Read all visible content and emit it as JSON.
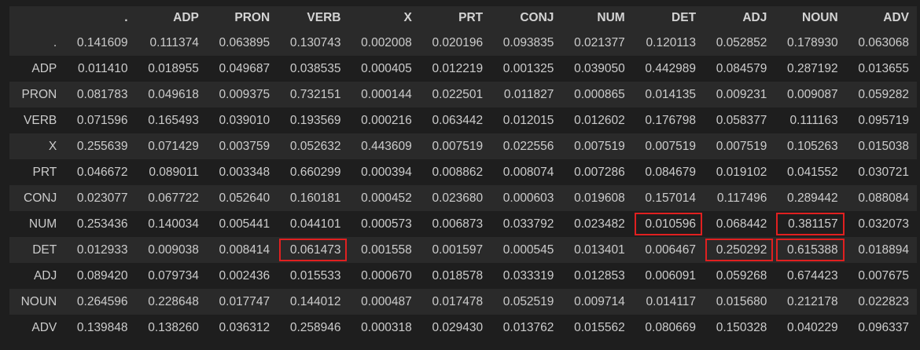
{
  "table": {
    "columns": [
      ".",
      "ADP",
      "PRON",
      "VERB",
      "X",
      "PRT",
      "CONJ",
      "NUM",
      "DET",
      "ADJ",
      "NOUN",
      "ADV"
    ],
    "rows": [
      {
        "label": ".",
        "values": [
          "0.141609",
          "0.111374",
          "0.063895",
          "0.130743",
          "0.002008",
          "0.020196",
          "0.093835",
          "0.021377",
          "0.120113",
          "0.052852",
          "0.178930",
          "0.063068"
        ],
        "highlight": []
      },
      {
        "label": "ADP",
        "values": [
          "0.011410",
          "0.018955",
          "0.049687",
          "0.038535",
          "0.000405",
          "0.012219",
          "0.001325",
          "0.039050",
          "0.442989",
          "0.084579",
          "0.287192",
          "0.013655"
        ],
        "highlight": []
      },
      {
        "label": "PRON",
        "values": [
          "0.081783",
          "0.049618",
          "0.009375",
          "0.732151",
          "0.000144",
          "0.022501",
          "0.011827",
          "0.000865",
          "0.014135",
          "0.009231",
          "0.009087",
          "0.059282"
        ],
        "highlight": []
      },
      {
        "label": "VERB",
        "values": [
          "0.071596",
          "0.165493",
          "0.039010",
          "0.193569",
          "0.000216",
          "0.063442",
          "0.012015",
          "0.012602",
          "0.176798",
          "0.058377",
          "0.111163",
          "0.095719"
        ],
        "highlight": []
      },
      {
        "label": "X",
        "values": [
          "0.255639",
          "0.071429",
          "0.003759",
          "0.052632",
          "0.443609",
          "0.007519",
          "0.022556",
          "0.007519",
          "0.007519",
          "0.007519",
          "0.105263",
          "0.015038"
        ],
        "highlight": []
      },
      {
        "label": "PRT",
        "values": [
          "0.046672",
          "0.089011",
          "0.003348",
          "0.660299",
          "0.000394",
          "0.008862",
          "0.008074",
          "0.007286",
          "0.084679",
          "0.019102",
          "0.041552",
          "0.030721"
        ],
        "highlight": []
      },
      {
        "label": "CONJ",
        "values": [
          "0.023077",
          "0.067722",
          "0.052640",
          "0.160181",
          "0.000452",
          "0.023680",
          "0.000603",
          "0.019608",
          "0.157014",
          "0.117496",
          "0.289442",
          "0.088084"
        ],
        "highlight": []
      },
      {
        "label": "NUM",
        "values": [
          "0.253436",
          "0.140034",
          "0.005441",
          "0.044101",
          "0.000573",
          "0.006873",
          "0.033792",
          "0.023482",
          "0.010596",
          "0.068442",
          "0.381157",
          "0.032073"
        ],
        "highlight": [
          8,
          10
        ]
      },
      {
        "label": "DET",
        "values": [
          "0.012933",
          "0.009038",
          "0.008414",
          "0.061473",
          "0.001558",
          "0.001597",
          "0.000545",
          "0.013401",
          "0.006467",
          "0.250292",
          "0.615388",
          "0.018894"
        ],
        "highlight": [
          3,
          9,
          10
        ]
      },
      {
        "label": "ADJ",
        "values": [
          "0.089420",
          "0.079734",
          "0.002436",
          "0.015533",
          "0.000670",
          "0.018578",
          "0.033319",
          "0.012853",
          "0.006091",
          "0.059268",
          "0.674423",
          "0.007675"
        ],
        "highlight": []
      },
      {
        "label": "NOUN",
        "values": [
          "0.264596",
          "0.228648",
          "0.017747",
          "0.144012",
          "0.000487",
          "0.017478",
          "0.052519",
          "0.009714",
          "0.014117",
          "0.015680",
          "0.212178",
          "0.022823"
        ],
        "highlight": []
      },
      {
        "label": "ADV",
        "values": [
          "0.139848",
          "0.138260",
          "0.036312",
          "0.258946",
          "0.000318",
          "0.029430",
          "0.013762",
          "0.015562",
          "0.080669",
          "0.150328",
          "0.040229",
          "0.096337"
        ],
        "highlight": []
      }
    ],
    "highlight_color": "#e02020"
  }
}
